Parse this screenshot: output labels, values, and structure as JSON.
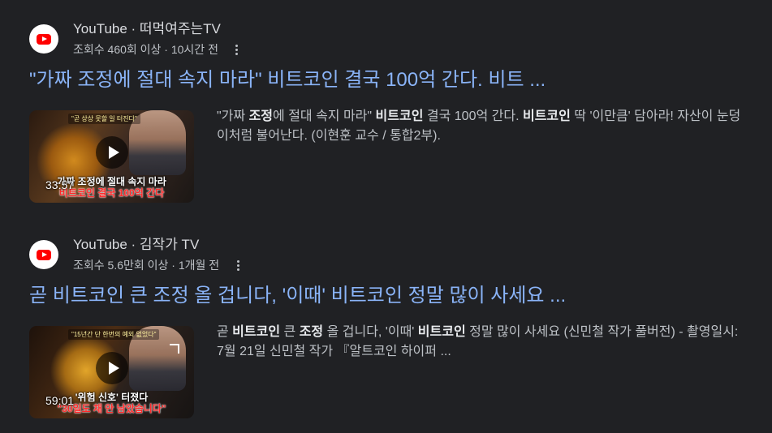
{
  "results": [
    {
      "source": "YouTube · 떠먹여주는TV",
      "meta": "조회수 460회 이상 · 10시간 전",
      "title": "\"가짜 조정에 절대 속지 마라\" 비트코인 결국 100억 간다. 비트 ...",
      "duration": "33:57",
      "thumb_tag": "\"곧 상상 못할 일 터진다\"",
      "thumb_caption_1": "가짜 조정에 절대 속지 마라",
      "thumb_caption_2": "비트코인 결국 100억 간다",
      "snippet": [
        {
          "text": "\"가짜 ",
          "bold": false
        },
        {
          "text": "조정",
          "bold": true
        },
        {
          "text": "에 절대 속지 마라\" ",
          "bold": false
        },
        {
          "text": "비트코인",
          "bold": true
        },
        {
          "text": " 결국 100억 간다. ",
          "bold": false
        },
        {
          "text": "비트코인",
          "bold": true
        },
        {
          "text": " 딱 '이만큼' 담아라! 자산이 눈덩이처럼 불어난다. (이현훈 교수 / 통합2부).",
          "bold": false
        }
      ]
    },
    {
      "source": "YouTube · 김작가 TV",
      "meta": "조회수 5.6만회 이상 · 1개월 전",
      "title": "곧 비트코인 큰 조정 올 겁니다, '이때' 비트코인 정말 많이 사세요 ...",
      "duration": "59:01",
      "thumb_tag": "\"15년간 단 한번의 예외 없었다\"",
      "thumb_caption_1": "'위험 신호' 터졌다",
      "thumb_caption_2": "\"30일도 채 안 남았습니다\"",
      "snippet": [
        {
          "text": "곧 ",
          "bold": false
        },
        {
          "text": "비트코인",
          "bold": true
        },
        {
          "text": " 큰 ",
          "bold": false
        },
        {
          "text": "조정",
          "bold": true
        },
        {
          "text": " 올 겁니다, '이때' ",
          "bold": false
        },
        {
          "text": "비트코인",
          "bold": true
        },
        {
          "text": " 정말 많이 사세요 (신민철 작가 풀버전) - 촬영일시: 7월 21일 신민철 작가 『알트코인 하이퍼 ...",
          "bold": false
        }
      ]
    }
  ],
  "icons": {
    "favicon": "youtube-logo-icon",
    "more": "more-vert-icon",
    "play": "play-icon",
    "expand": "expand-icon"
  },
  "colors": {
    "background": "#202124",
    "link": "#8ab4f8",
    "text": "#bdc1c6",
    "youtube_red": "#ff0000"
  }
}
